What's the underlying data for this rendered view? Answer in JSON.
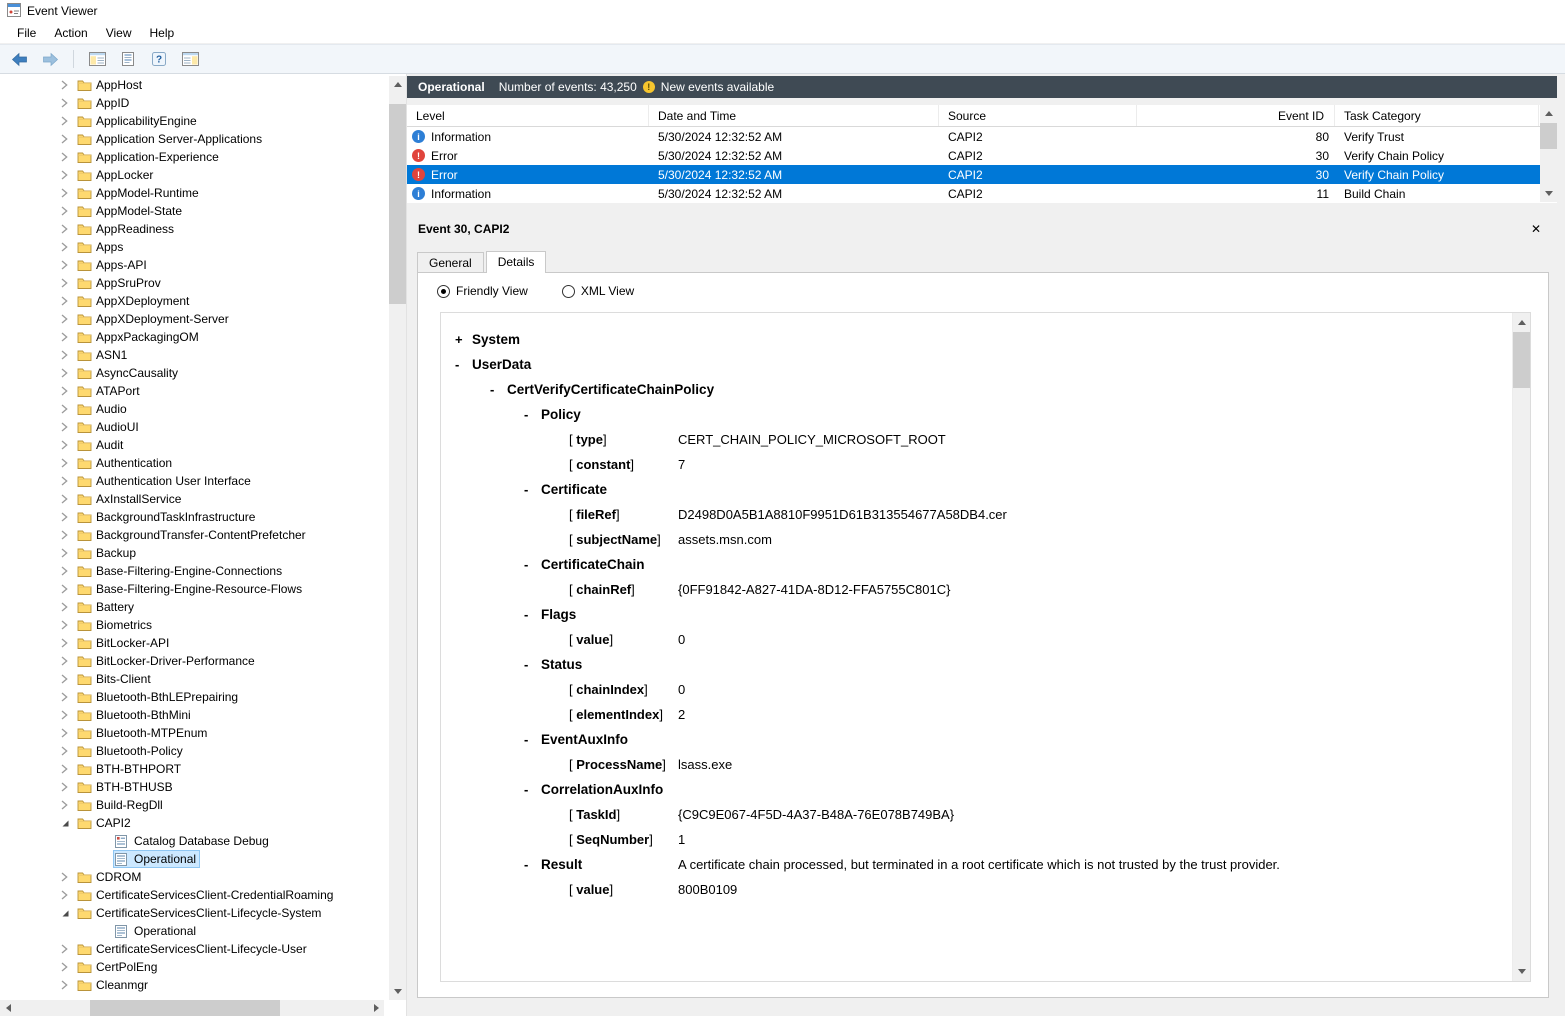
{
  "colors": {
    "selection": "#0078d7",
    "header_bar": "#3f4a54",
    "info": "#2d7fd6",
    "error": "#e0443c",
    "tree_selection": "#cce8ff"
  },
  "window": {
    "title": "Event Viewer"
  },
  "menu": {
    "items": [
      "File",
      "Action",
      "View",
      "Help"
    ]
  },
  "toolbar": {
    "icons": [
      "back-icon",
      "forward-icon",
      "console-tree-icon",
      "export-icon",
      "help-icon",
      "action-pane-icon"
    ]
  },
  "tree": {
    "items": [
      "AppHost",
      "AppID",
      "ApplicabilityEngine",
      "Application Server-Applications",
      "Application-Experience",
      "AppLocker",
      "AppModel-Runtime",
      "AppModel-State",
      "AppReadiness",
      "Apps",
      "Apps-API",
      "AppSruProv",
      "AppXDeployment",
      "AppXDeployment-Server",
      "AppxPackagingOM",
      "ASN1",
      "AsyncCausality",
      "ATAPort",
      "Audio",
      "AudioUI",
      "Audit",
      "Authentication",
      "Authentication User Interface",
      "AxInstallService",
      "BackgroundTaskInfrastructure",
      "BackgroundTransfer-ContentPrefetcher",
      "Backup",
      "Base-Filtering-Engine-Connections",
      "Base-Filtering-Engine-Resource-Flows",
      "Battery",
      "Biometrics",
      "BitLocker-API",
      "BitLocker-Driver-Performance",
      "Bits-Client",
      "Bluetooth-BthLEPrepairing",
      "Bluetooth-BthMini",
      "Bluetooth-MTPEnum",
      "Bluetooth-Policy",
      "BTH-BTHPORT",
      "BTH-BTHUSB",
      "Build-RegDll",
      {
        "label": "CAPI2",
        "depth": 0,
        "chevron": "expanded",
        "icon": "folder-icon"
      },
      {
        "label": "Catalog Database Debug",
        "depth": 1,
        "chevron": "none",
        "icon": "debug-log-icon"
      },
      {
        "label": "Operational",
        "depth": 1,
        "chevron": "none",
        "icon": "log-icon",
        "selected": true
      },
      "CDROM",
      "CertificateServicesClient-CredentialRoaming",
      {
        "label": "CertificateServicesClient-Lifecycle-System",
        "depth": 0,
        "chevron": "expanded",
        "icon": "folder-icon"
      },
      {
        "label": "Operational",
        "depth": 1,
        "chevron": "none",
        "icon": "log-icon"
      },
      "CertificateServicesClient-Lifecycle-User",
      "CertPolEng",
      "Cleanmgr"
    ]
  },
  "list": {
    "title": "Operational",
    "events_count": "Number of events: 43,250",
    "new_events": "New events available",
    "columns": [
      "Level",
      "Date and Time",
      "Source",
      "Event ID",
      "Task Category"
    ],
    "rows": [
      {
        "icon": "info-icon",
        "level": "Information",
        "datetime": "5/30/2024 12:32:52 AM",
        "source": "CAPI2",
        "event_id": "80",
        "task_category": "Verify Trust",
        "selected": false
      },
      {
        "icon": "error-icon",
        "level": "Error",
        "datetime": "5/30/2024 12:32:52 AM",
        "source": "CAPI2",
        "event_id": "30",
        "task_category": "Verify Chain Policy",
        "selected": false
      },
      {
        "icon": "error-icon",
        "level": "Error",
        "datetime": "5/30/2024 12:32:52 AM",
        "source": "CAPI2",
        "event_id": "30",
        "task_category": "Verify Chain Policy",
        "selected": true
      },
      {
        "icon": "info-icon",
        "level": "Information",
        "datetime": "5/30/2024 12:32:52 AM",
        "source": "CAPI2",
        "event_id": "11",
        "task_category": "Build Chain",
        "selected": false
      }
    ]
  },
  "detail": {
    "title": "Event 30, CAPI2",
    "tabs": [
      {
        "label": "General",
        "active": false
      },
      {
        "label": "Details",
        "active": true
      }
    ],
    "views": {
      "friendly": "Friendly View",
      "xml": "XML View",
      "selected": "friendly"
    },
    "nodes": [
      {
        "type": "section",
        "sign": "+",
        "depth": 0,
        "label": "System",
        "value": ""
      },
      {
        "type": "section",
        "sign": "-",
        "depth": 0,
        "label": "UserData",
        "value": ""
      },
      {
        "type": "section",
        "sign": "-",
        "depth": 1,
        "label": "CertVerifyCertificateChainPolicy",
        "value": ""
      },
      {
        "type": "section",
        "sign": "-",
        "depth": 2,
        "label": "Policy",
        "value": ""
      },
      {
        "type": "prop",
        "name": "type",
        "value": "CERT_CHAIN_POLICY_MICROSOFT_ROOT"
      },
      {
        "type": "prop",
        "name": "constant",
        "value": "7"
      },
      {
        "type": "section",
        "sign": "-",
        "depth": 2,
        "label": "Certificate",
        "value": ""
      },
      {
        "type": "prop",
        "name": "fileRef",
        "value": "D2498D0A5B1A8810F9951D61B313554677A58DB4.cer"
      },
      {
        "type": "prop",
        "name": "subjectName",
        "value": "assets.msn.com"
      },
      {
        "type": "section",
        "sign": "-",
        "depth": 2,
        "label": "CertificateChain",
        "value": ""
      },
      {
        "type": "prop",
        "name": "chainRef",
        "value": "{0FF91842-A827-41DA-8D12-FFA5755C801C}"
      },
      {
        "type": "section",
        "sign": "-",
        "depth": 2,
        "label": "Flags",
        "value": ""
      },
      {
        "type": "prop",
        "name": "value",
        "value": "0"
      },
      {
        "type": "section",
        "sign": "-",
        "depth": 2,
        "label": "Status",
        "value": ""
      },
      {
        "type": "prop",
        "name": "chainIndex",
        "value": "0"
      },
      {
        "type": "prop",
        "name": "elementIndex",
        "value": "2"
      },
      {
        "type": "section",
        "sign": "-",
        "depth": 2,
        "label": "EventAuxInfo",
        "value": ""
      },
      {
        "type": "prop",
        "name": "ProcessName",
        "value": "lsass.exe"
      },
      {
        "type": "section",
        "sign": "-",
        "depth": 2,
        "label": "CorrelationAuxInfo",
        "value": ""
      },
      {
        "type": "prop",
        "name": "TaskId",
        "value": "{C9C9E067-4F5D-4A37-B48A-76E078B749BA}"
      },
      {
        "type": "prop",
        "name": "SeqNumber",
        "value": "1"
      },
      {
        "type": "section",
        "sign": "-",
        "depth": 2,
        "label": "Result",
        "value": "A certificate chain processed, but terminated in a root certificate which is not trusted by the trust provider."
      },
      {
        "type": "prop",
        "name": "value",
        "value": "800B0109"
      }
    ]
  }
}
